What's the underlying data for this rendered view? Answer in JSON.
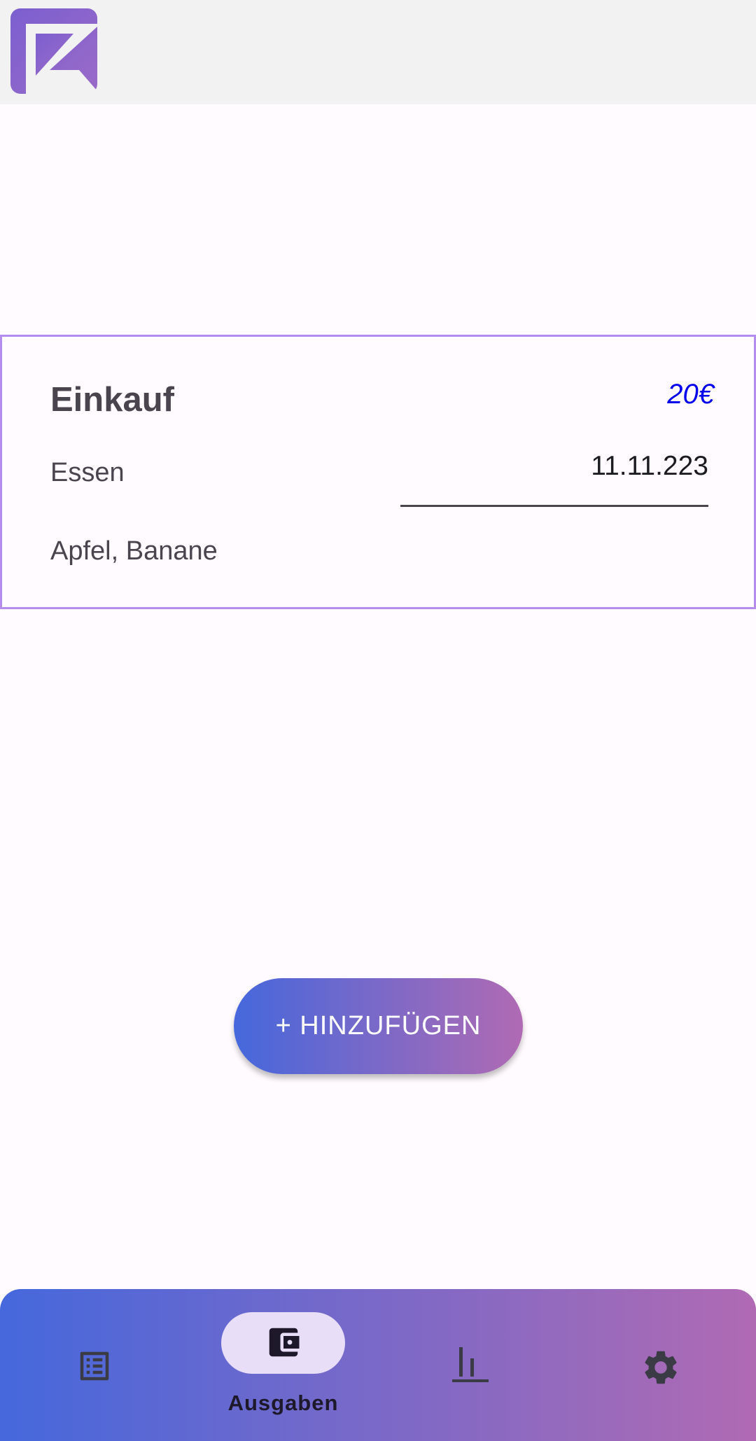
{
  "app": {
    "logo_icon": "app-logo-icon"
  },
  "expense": {
    "title": "Einkauf",
    "amount": "20€",
    "category": "Essen",
    "date": "11.11.223",
    "description": "Apfel, Banane"
  },
  "actions": {
    "add_label": "+ HINZUFÜGEN"
  },
  "nav": {
    "items": [
      {
        "icon": "list-icon",
        "label": ""
      },
      {
        "icon": "wallet-icon",
        "label": "Ausgaben",
        "selected": true
      },
      {
        "icon": "bar-chart-icon",
        "label": ""
      },
      {
        "icon": "gear-icon",
        "label": ""
      }
    ]
  },
  "colors": {
    "accent_gradient_start": "#4568dc",
    "accent_gradient_end": "#b06ab3",
    "card_border": "#b58cf0",
    "amount_text": "#0000ee",
    "selected_pill": "#e8def8"
  }
}
